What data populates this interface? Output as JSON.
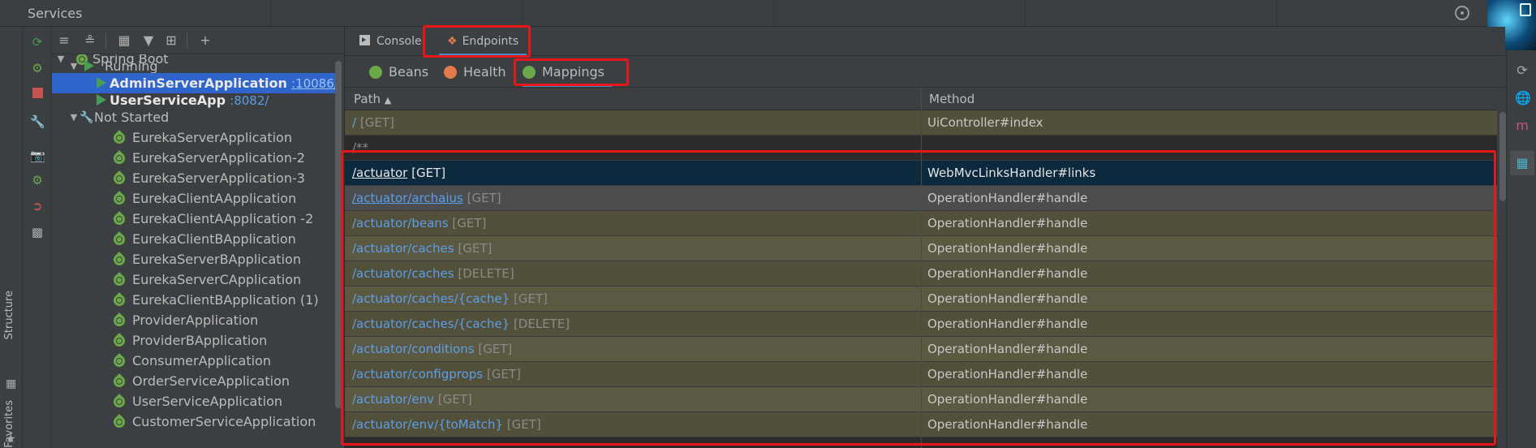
{
  "window": {
    "title": "Services"
  },
  "left_strip": {
    "structure": "Structure",
    "favorites": "Favorites"
  },
  "tree": {
    "group": "Spring Boot",
    "running": {
      "label": "Running",
      "items": [
        {
          "name": "AdminServerApplication",
          "port": ":10086/"
        },
        {
          "name": "UserServiceApp",
          "port": ":8082/"
        }
      ]
    },
    "not_started": {
      "label": "Not Started",
      "items": [
        "EurekaServerApplication",
        "EurekaServerApplication-2",
        "EurekaServerApplication-3",
        "EurekaClientAApplication",
        "EurekaClientAApplication -2",
        "EurekaClientBApplication",
        "EurekaServerBApplication",
        "EurekaServerCApplication",
        "EurekaClientBApplication (1)",
        "ProviderApplication",
        "ProviderBApplication",
        "ConsumerApplication",
        "OrderServiceApplication",
        "UserServiceApplication",
        "CustomerServiceApplication"
      ]
    }
  },
  "tabs": {
    "console": "Console",
    "endpoints": "Endpoints"
  },
  "subtabs": {
    "beans": "Beans",
    "health": "Health",
    "mappings": "Mappings"
  },
  "table": {
    "headers": {
      "path": "Path",
      "method": "Method"
    },
    "rows": [
      {
        "path": "/",
        "verb": "[GET]",
        "method": "UiController#index"
      },
      {
        "path": "",
        "verb": "/**",
        "method": ""
      },
      {
        "path": "/actuator",
        "verb": "[GET]",
        "method": "WebMvcLinksHandler#links"
      },
      {
        "path": "/actuator/archaius",
        "verb": "[GET]",
        "method": "OperationHandler#handle"
      },
      {
        "path": "/actuator/beans",
        "verb": "[GET]",
        "method": "OperationHandler#handle"
      },
      {
        "path": "/actuator/caches",
        "verb": "[GET]",
        "method": "OperationHandler#handle"
      },
      {
        "path": "/actuator/caches",
        "verb": "[DELETE]",
        "method": "OperationHandler#handle"
      },
      {
        "path": "/actuator/caches/{cache}",
        "verb": "[GET]",
        "method": "OperationHandler#handle"
      },
      {
        "path": "/actuator/caches/{cache}",
        "verb": "[DELETE]",
        "method": "OperationHandler#handle"
      },
      {
        "path": "/actuator/conditions",
        "verb": "[GET]",
        "method": "OperationHandler#handle"
      },
      {
        "path": "/actuator/configprops",
        "verb": "[GET]",
        "method": "OperationHandler#handle"
      },
      {
        "path": "/actuator/env",
        "verb": "[GET]",
        "method": "OperationHandler#handle"
      },
      {
        "path": "/actuator/env/{toMatch}",
        "verb": "[GET]",
        "method": "OperationHandler#handle"
      }
    ]
  },
  "colors": {
    "highlight": "#e8151b",
    "selection": "#2f65ca",
    "link": "#5c9ee8"
  }
}
